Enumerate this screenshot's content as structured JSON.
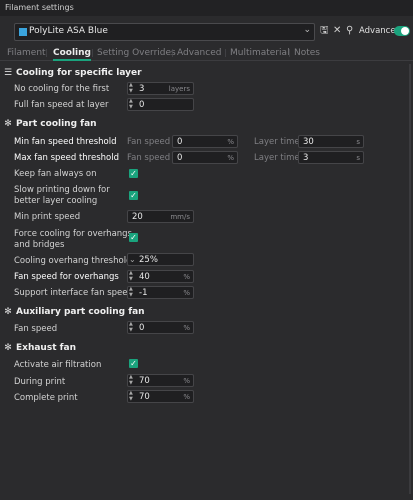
{
  "window": {
    "title": "Filament settings"
  },
  "preset": {
    "name": "PolyLite ASA Blue",
    "swatch_color": "#3aa4dd",
    "advanced_label": "Advanced",
    "advanced_on": true
  },
  "tabs": [
    "Filament",
    "Cooling",
    "Setting Overrides",
    "Advanced",
    "Multimaterial",
    "Notes"
  ],
  "active_tab": "Cooling",
  "sections": {
    "specific_layer": {
      "title": "Cooling for specific layer",
      "no_cooling": {
        "label": "No cooling for the first",
        "value": "3",
        "unit": "layers"
      },
      "full_fan": {
        "label": "Full fan speed at layer",
        "value": "0"
      }
    },
    "part_cooling": {
      "title": "Part cooling fan",
      "min_fan": {
        "label": "Min fan speed threshold",
        "fan_label": "Fan speed",
        "fan_value": "0",
        "fan_unit": "%",
        "time_label": "Layer time",
        "time_value": "30",
        "time_unit": "s"
      },
      "max_fan": {
        "label": "Max fan speed threshold",
        "fan_label": "Fan speed",
        "fan_value": "0",
        "fan_unit": "%",
        "time_label": "Layer time",
        "time_value": "3",
        "time_unit": "s"
      },
      "keep_fan": {
        "label": "Keep fan always on",
        "checked": true
      },
      "slow_printing": {
        "label_line1": "Slow printing down for",
        "label_line2": "better layer cooling",
        "checked": true
      },
      "min_print_speed": {
        "label": "Min print speed",
        "value": "20",
        "unit": "mm/s"
      },
      "force_cooling": {
        "label_line1": "Force cooling for overhangs",
        "label_line2": "and bridges",
        "checked": true
      },
      "overhang_threshold": {
        "label": "Cooling overhang threshold",
        "value": "25%"
      },
      "overhang_fan": {
        "label": "Fan speed for overhangs",
        "value": "40",
        "unit": "%"
      },
      "support_fan": {
        "label": "Support interface fan speed",
        "value": "-1",
        "unit": "%"
      }
    },
    "auxiliary": {
      "title": "Auxiliary part cooling fan",
      "fan_speed": {
        "label": "Fan speed",
        "value": "0",
        "unit": "%"
      }
    },
    "exhaust": {
      "title": "Exhaust fan",
      "activate": {
        "label": "Activate air filtration",
        "checked": true
      },
      "during": {
        "label": "During print",
        "value": "70",
        "unit": "%"
      },
      "complete": {
        "label": "Complete print",
        "value": "70",
        "unit": "%"
      }
    }
  },
  "colors": {
    "accent": "#1aa37d",
    "background": "#2b2b2d",
    "field_bg": "#1f1f21"
  }
}
